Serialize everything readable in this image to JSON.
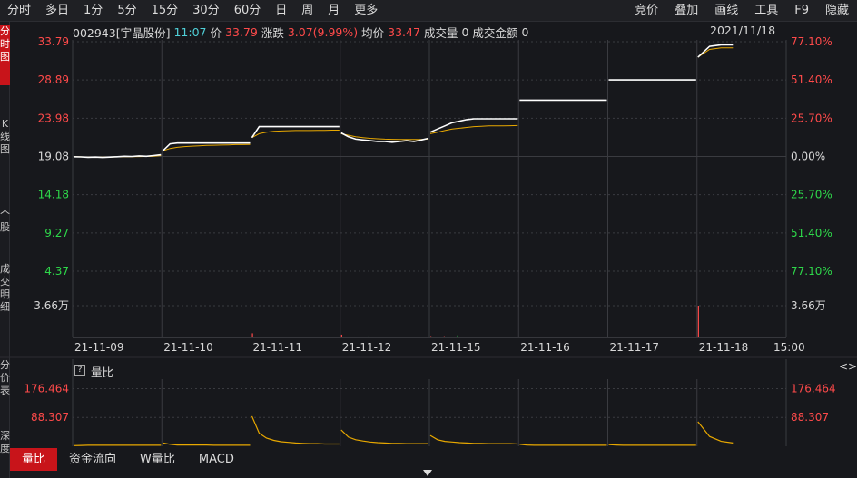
{
  "toolbar": {
    "timeframes": [
      "分时",
      "多日",
      "1分",
      "5分",
      "15分",
      "30分",
      "60分",
      "日",
      "周",
      "月",
      "更多"
    ],
    "active_index": 0,
    "tools": [
      "竞价",
      "叠加",
      "画线",
      "工具",
      "F9",
      "隐藏"
    ]
  },
  "sidebar": {
    "tabs": [
      "分时图",
      "K线图",
      "个股",
      "成交明细",
      "分价表",
      "深度"
    ]
  },
  "info": {
    "code_name": "002943[宇晶股份]",
    "time": "11:07",
    "price_label": "价",
    "price": "33.79",
    "change_label": "涨跌",
    "change": "3.07(9.99%)",
    "avg_label": "均价",
    "avg": "33.47",
    "volume_label": "成交量",
    "volume": "0",
    "amount_label": "成交金额",
    "amount": "0",
    "date": "2021/11/18"
  },
  "indicator": {
    "title": "量比",
    "help": "?",
    "tabs": [
      "量比",
      "资金流向",
      "W量比",
      "MACD"
    ],
    "active_index": 0
  },
  "colors": {
    "up": "#ff4a4a",
    "down": "#2ed84a",
    "price_line": "#ffffff",
    "avg_line": "#e8a800",
    "grid": "#3a3b40",
    "active": "#c8141a"
  },
  "chart_data": {
    "type": "line",
    "price_axis": {
      "ticks": [
        33.79,
        28.89,
        23.98,
        19.08,
        14.18,
        9.27,
        4.37
      ],
      "tick_labels": [
        "33.79",
        "28.89",
        "23.98",
        "19.08",
        "14.18",
        "9.27",
        "4.37"
      ],
      "ylim": [
        4.37,
        33.79
      ],
      "base": 19.08
    },
    "pct_axis": {
      "tick_labels": [
        "77.10%",
        "51.40%",
        "25.70%",
        "0.00%",
        "25.70%",
        "51.40%",
        "77.10%"
      ]
    },
    "volume_axis": {
      "max_label": "3.66万"
    },
    "x_labels": [
      "21-11-09",
      "21-11-10",
      "21-11-11",
      "21-11-12",
      "21-11-15",
      "21-11-16",
      "21-11-17",
      "21-11-18",
      "15:00"
    ],
    "days": [
      {
        "date": "21-11-09",
        "price": [
          19.05,
          19.02,
          18.98,
          19.0,
          18.95,
          19.0,
          19.05,
          19.1,
          19.08,
          19.15,
          19.1,
          19.2,
          19.3
        ],
        "avg": [
          19.05,
          19.03,
          19.0,
          19.0,
          19.0,
          19.0,
          19.02,
          19.04,
          19.05,
          19.07,
          19.08,
          19.12,
          19.2
        ]
      },
      {
        "date": "21-11-10",
        "price": [
          19.8,
          20.7,
          20.8,
          20.8,
          20.8,
          20.8,
          20.8,
          20.8,
          20.8,
          20.8,
          20.8,
          20.8,
          20.8
        ],
        "avg": [
          19.8,
          20.1,
          20.25,
          20.35,
          20.4,
          20.45,
          20.5,
          20.52,
          20.55,
          20.57,
          20.6,
          20.6,
          20.62
        ]
      },
      {
        "date": "21-11-11",
        "price": [
          21.5,
          22.9,
          22.9,
          22.9,
          22.9,
          22.9,
          22.9,
          22.9,
          22.9,
          22.9,
          22.9,
          22.9,
          22.9
        ],
        "avg": [
          21.5,
          22.0,
          22.2,
          22.3,
          22.35,
          22.38,
          22.4,
          22.4,
          22.4,
          22.42,
          22.42,
          22.45,
          22.45
        ]
      },
      {
        "date": "21-11-12",
        "price": [
          22.1,
          21.6,
          21.3,
          21.2,
          21.1,
          21.0,
          21.0,
          20.9,
          21.0,
          21.1,
          21.0,
          21.2,
          21.4
        ],
        "avg": [
          22.0,
          21.8,
          21.6,
          21.5,
          21.4,
          21.35,
          21.3,
          21.28,
          21.27,
          21.26,
          21.26,
          21.27,
          21.3
        ]
      },
      {
        "date": "21-11-15",
        "price": [
          22.2,
          22.6,
          23.0,
          23.4,
          23.6,
          23.8,
          23.9,
          23.9,
          23.9,
          23.9,
          23.9,
          23.9,
          23.9
        ],
        "avg": [
          22.0,
          22.2,
          22.4,
          22.6,
          22.7,
          22.8,
          22.9,
          22.95,
          23.0,
          23.0,
          23.0,
          23.02,
          23.05
        ]
      },
      {
        "date": "21-11-16",
        "price": [
          26.3,
          26.3,
          26.3,
          26.3,
          26.3,
          26.3,
          26.3,
          26.3,
          26.3,
          26.3,
          26.3,
          26.3,
          26.3
        ],
        "avg": []
      },
      {
        "date": "21-11-17",
        "price": [
          28.9,
          28.9,
          28.9,
          28.9,
          28.9,
          28.9,
          28.9,
          28.9,
          28.9,
          28.9,
          28.9,
          28.9,
          28.9
        ],
        "avg": []
      },
      {
        "date": "21-11-18",
        "price": [
          31.8,
          33.2,
          33.4,
          33.4
        ],
        "avg": [
          31.8,
          32.8,
          33.0,
          33.0
        ]
      }
    ],
    "volume": {
      "ylim": [
        0,
        36600
      ],
      "days": [
        [
          400,
          150,
          120,
          300,
          100,
          200,
          120,
          250,
          130,
          180,
          90,
          160,
          210
        ],
        [
          700,
          300,
          200,
          150,
          120,
          100,
          150,
          90,
          100,
          80,
          120,
          90,
          110
        ],
        [
          4800,
          400,
          250,
          200,
          150,
          100,
          100,
          80,
          90,
          70,
          80,
          90,
          120
        ],
        [
          3200,
          800,
          900,
          700,
          1100,
          500,
          600,
          400,
          700,
          500,
          450,
          350,
          500
        ],
        [
          1500,
          900,
          1400,
          700,
          2400,
          600,
          500,
          300,
          250,
          200,
          180,
          160,
          150
        ],
        [
          600,
          80,
          60,
          50,
          40,
          40,
          30,
          30,
          30,
          30,
          30,
          30,
          30
        ],
        [
          700,
          60,
          50,
          40,
          40,
          30,
          30,
          30,
          30,
          30,
          30,
          30,
          30
        ],
        [
          36600,
          300,
          200,
          150
        ]
      ]
    },
    "volume_ratio": {
      "ticks": [
        176.464,
        88.307
      ],
      "tick_labels": [
        "176.464",
        "88.307"
      ],
      "ylim": [
        0,
        200
      ],
      "days": [
        [
          2,
          2.5,
          3,
          3,
          3,
          3,
          3,
          3,
          3,
          3,
          3,
          3,
          3
        ],
        [
          10,
          6,
          4,
          4,
          4,
          4,
          4,
          3,
          3,
          3,
          3,
          3,
          3
        ],
        [
          92,
          40,
          25,
          18,
          14,
          12,
          10,
          9,
          8,
          8,
          7,
          7,
          7
        ],
        [
          50,
          28,
          20,
          16,
          13,
          11,
          10,
          9,
          9,
          8,
          8,
          8,
          8
        ],
        [
          33,
          20,
          15,
          13,
          11,
          10,
          9,
          9,
          8,
          8,
          8,
          8,
          7
        ],
        [
          6,
          4,
          3,
          3,
          3,
          3,
          3,
          3,
          3,
          3,
          3,
          3,
          3
        ],
        [
          5,
          4,
          3,
          3,
          3,
          3,
          3,
          3,
          3,
          3,
          3,
          3,
          3
        ],
        [
          75,
          30,
          15,
          10
        ]
      ]
    }
  }
}
